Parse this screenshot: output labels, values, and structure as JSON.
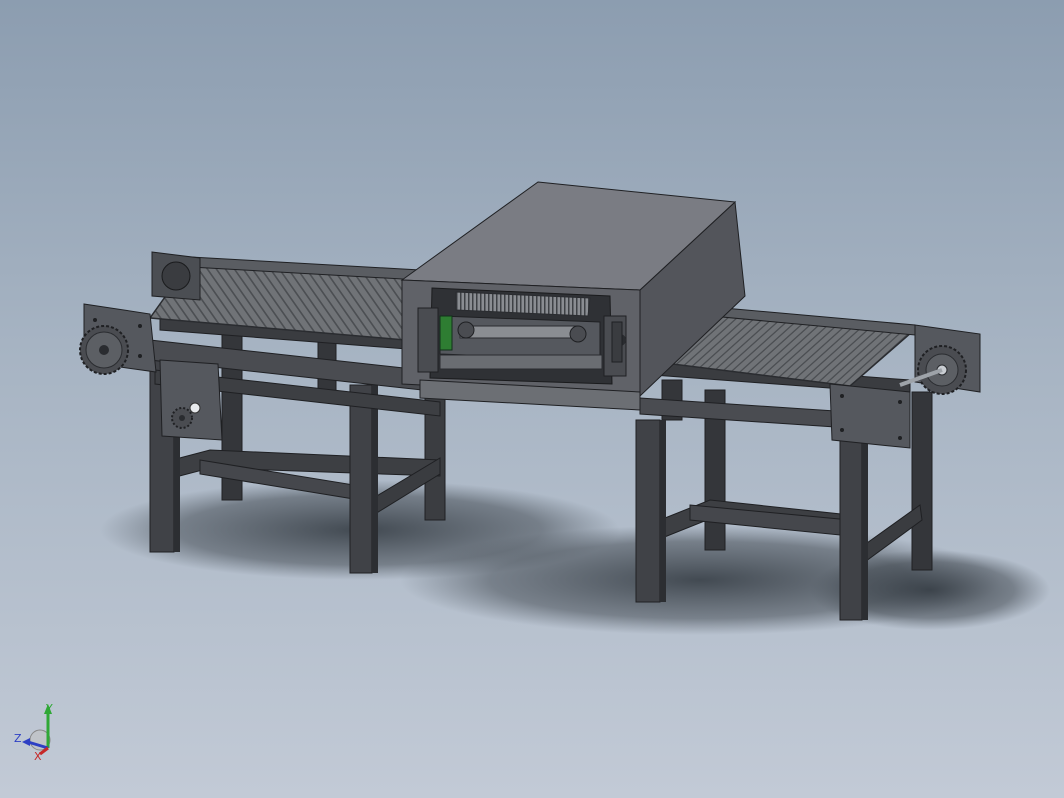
{
  "viewport": {
    "background_top": "#8c9db0",
    "background_bottom": "#c2cad6"
  },
  "model": {
    "name": "",
    "colors": {
      "frame": "#3d3f43",
      "frame_light": "#55585e",
      "frame_dark": "#2a2c30",
      "belt": "#6f7276",
      "belt_slat": "#4e5155",
      "hood_top": "#74767d",
      "hood_side": "#55575d",
      "hood_front": "#5f6167",
      "accent_green": "#2e7d32",
      "shadow": "#3a4148"
    }
  },
  "triad": {
    "y_label": "Y",
    "z_label": "Z",
    "x_label": "X",
    "y_color": "#2fa836",
    "z_color": "#2d3fc4",
    "x_color": "#c62828"
  }
}
